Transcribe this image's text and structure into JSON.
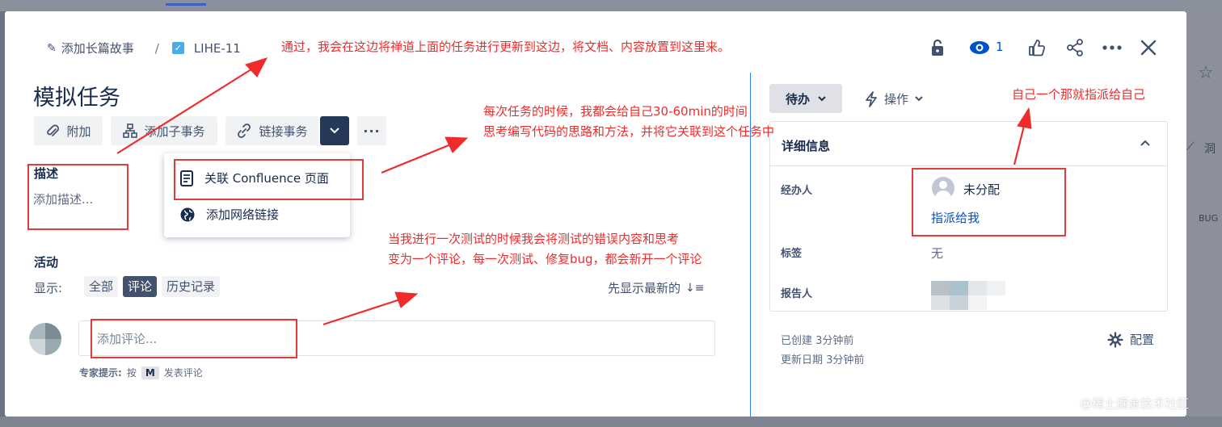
{
  "breadcrumb": {
    "epic_label": "添加长篇故事",
    "separator": "/",
    "issue_key": "LIHE-11"
  },
  "header": {
    "watch_count": "1"
  },
  "issue": {
    "title": "模拟任务"
  },
  "toolbar": {
    "attach_label": "附加",
    "add_child_label": "添加子事务",
    "link_issue_label": "链接事务",
    "more_label": "···"
  },
  "link_menu": {
    "items": [
      "关联 Confluence 页面",
      "添加网络链接"
    ]
  },
  "description": {
    "heading": "描述",
    "placeholder": "添加描述..."
  },
  "activity": {
    "heading": "活动",
    "show_label": "显示:",
    "tabs": [
      "全部",
      "评论",
      "历史记录"
    ],
    "selected_tab": "评论",
    "sort_label": "先显示最新的",
    "comment_placeholder": "添加评论...",
    "pro_tip_label": "专家提示:",
    "pro_tip_press": "按",
    "pro_tip_key": "M",
    "pro_tip_action": "发表评论"
  },
  "sidebar": {
    "status_label": "待办",
    "actions_label": "操作",
    "details_heading": "详细信息",
    "assignee_label": "经办人",
    "assignee_value": "未分配",
    "assign_to_me": "指派给我",
    "labels_label": "标签",
    "labels_value": "无",
    "reporter_label": "报告人",
    "created": "已创建 3分钟前",
    "updated": "更新日期 3分钟前",
    "configure_label": "配置"
  },
  "annotations": {
    "top": "通过，我会在这边将禅道上面的任务进行更新到这边，将文档、内容放置到这里来。",
    "middle_line1": "每次任务的时候，我都会给自己30-60min的时间",
    "middle_line2": "思考编写代码的思路和方法，并将它关联到这个任务中",
    "right": "自己一个那就指派给自己",
    "bottom_line1": "当我进行一次测试的时候我会将测试的错误内容和思考",
    "bottom_line2": "变为一个评论，每一次测试、修复bug，都会新开一个评论"
  },
  "background": {
    "right_label_1": "洞",
    "right_label_2": "BUG"
  },
  "watermark": "@稀土掘金技术社区",
  "colors": {
    "annotation_red": "#ef2b2b",
    "link_blue": "#0052cc",
    "dark_button": "#253858",
    "selected_tab": "#42526e",
    "divider_blue": "#2684ff"
  }
}
